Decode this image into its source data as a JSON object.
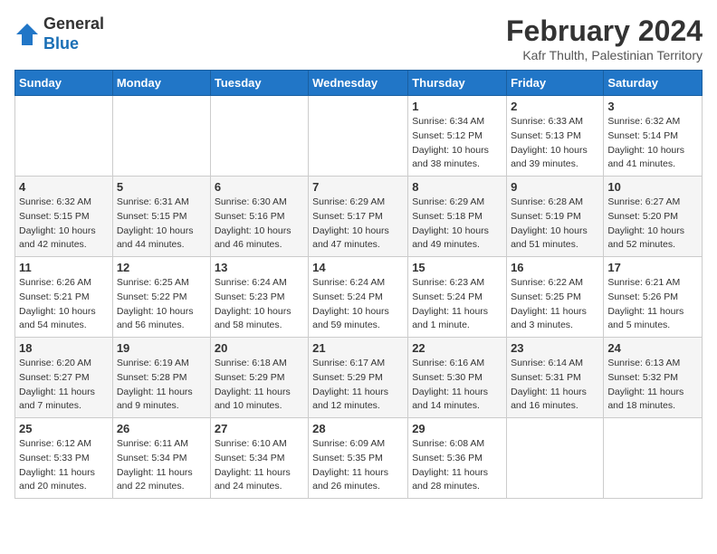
{
  "header": {
    "logo": {
      "line1": "General",
      "line2": "Blue"
    },
    "month_year": "February 2024",
    "location": "Kafr Thulth, Palestinian Territory"
  },
  "weekdays": [
    "Sunday",
    "Monday",
    "Tuesday",
    "Wednesday",
    "Thursday",
    "Friday",
    "Saturday"
  ],
  "weeks": [
    [
      {
        "day": "",
        "sunrise": "",
        "sunset": "",
        "daylight": ""
      },
      {
        "day": "",
        "sunrise": "",
        "sunset": "",
        "daylight": ""
      },
      {
        "day": "",
        "sunrise": "",
        "sunset": "",
        "daylight": ""
      },
      {
        "day": "",
        "sunrise": "",
        "sunset": "",
        "daylight": ""
      },
      {
        "day": "1",
        "sunrise": "Sunrise: 6:34 AM",
        "sunset": "Sunset: 5:12 PM",
        "daylight": "Daylight: 10 hours and 38 minutes."
      },
      {
        "day": "2",
        "sunrise": "Sunrise: 6:33 AM",
        "sunset": "Sunset: 5:13 PM",
        "daylight": "Daylight: 10 hours and 39 minutes."
      },
      {
        "day": "3",
        "sunrise": "Sunrise: 6:32 AM",
        "sunset": "Sunset: 5:14 PM",
        "daylight": "Daylight: 10 hours and 41 minutes."
      }
    ],
    [
      {
        "day": "4",
        "sunrise": "Sunrise: 6:32 AM",
        "sunset": "Sunset: 5:15 PM",
        "daylight": "Daylight: 10 hours and 42 minutes."
      },
      {
        "day": "5",
        "sunrise": "Sunrise: 6:31 AM",
        "sunset": "Sunset: 5:15 PM",
        "daylight": "Daylight: 10 hours and 44 minutes."
      },
      {
        "day": "6",
        "sunrise": "Sunrise: 6:30 AM",
        "sunset": "Sunset: 5:16 PM",
        "daylight": "Daylight: 10 hours and 46 minutes."
      },
      {
        "day": "7",
        "sunrise": "Sunrise: 6:29 AM",
        "sunset": "Sunset: 5:17 PM",
        "daylight": "Daylight: 10 hours and 47 minutes."
      },
      {
        "day": "8",
        "sunrise": "Sunrise: 6:29 AM",
        "sunset": "Sunset: 5:18 PM",
        "daylight": "Daylight: 10 hours and 49 minutes."
      },
      {
        "day": "9",
        "sunrise": "Sunrise: 6:28 AM",
        "sunset": "Sunset: 5:19 PM",
        "daylight": "Daylight: 10 hours and 51 minutes."
      },
      {
        "day": "10",
        "sunrise": "Sunrise: 6:27 AM",
        "sunset": "Sunset: 5:20 PM",
        "daylight": "Daylight: 10 hours and 52 minutes."
      }
    ],
    [
      {
        "day": "11",
        "sunrise": "Sunrise: 6:26 AM",
        "sunset": "Sunset: 5:21 PM",
        "daylight": "Daylight: 10 hours and 54 minutes."
      },
      {
        "day": "12",
        "sunrise": "Sunrise: 6:25 AM",
        "sunset": "Sunset: 5:22 PM",
        "daylight": "Daylight: 10 hours and 56 minutes."
      },
      {
        "day": "13",
        "sunrise": "Sunrise: 6:24 AM",
        "sunset": "Sunset: 5:23 PM",
        "daylight": "Daylight: 10 hours and 58 minutes."
      },
      {
        "day": "14",
        "sunrise": "Sunrise: 6:24 AM",
        "sunset": "Sunset: 5:24 PM",
        "daylight": "Daylight: 10 hours and 59 minutes."
      },
      {
        "day": "15",
        "sunrise": "Sunrise: 6:23 AM",
        "sunset": "Sunset: 5:24 PM",
        "daylight": "Daylight: 11 hours and 1 minute."
      },
      {
        "day": "16",
        "sunrise": "Sunrise: 6:22 AM",
        "sunset": "Sunset: 5:25 PM",
        "daylight": "Daylight: 11 hours and 3 minutes."
      },
      {
        "day": "17",
        "sunrise": "Sunrise: 6:21 AM",
        "sunset": "Sunset: 5:26 PM",
        "daylight": "Daylight: 11 hours and 5 minutes."
      }
    ],
    [
      {
        "day": "18",
        "sunrise": "Sunrise: 6:20 AM",
        "sunset": "Sunset: 5:27 PM",
        "daylight": "Daylight: 11 hours and 7 minutes."
      },
      {
        "day": "19",
        "sunrise": "Sunrise: 6:19 AM",
        "sunset": "Sunset: 5:28 PM",
        "daylight": "Daylight: 11 hours and 9 minutes."
      },
      {
        "day": "20",
        "sunrise": "Sunrise: 6:18 AM",
        "sunset": "Sunset: 5:29 PM",
        "daylight": "Daylight: 11 hours and 10 minutes."
      },
      {
        "day": "21",
        "sunrise": "Sunrise: 6:17 AM",
        "sunset": "Sunset: 5:29 PM",
        "daylight": "Daylight: 11 hours and 12 minutes."
      },
      {
        "day": "22",
        "sunrise": "Sunrise: 6:16 AM",
        "sunset": "Sunset: 5:30 PM",
        "daylight": "Daylight: 11 hours and 14 minutes."
      },
      {
        "day": "23",
        "sunrise": "Sunrise: 6:14 AM",
        "sunset": "Sunset: 5:31 PM",
        "daylight": "Daylight: 11 hours and 16 minutes."
      },
      {
        "day": "24",
        "sunrise": "Sunrise: 6:13 AM",
        "sunset": "Sunset: 5:32 PM",
        "daylight": "Daylight: 11 hours and 18 minutes."
      }
    ],
    [
      {
        "day": "25",
        "sunrise": "Sunrise: 6:12 AM",
        "sunset": "Sunset: 5:33 PM",
        "daylight": "Daylight: 11 hours and 20 minutes."
      },
      {
        "day": "26",
        "sunrise": "Sunrise: 6:11 AM",
        "sunset": "Sunset: 5:34 PM",
        "daylight": "Daylight: 11 hours and 22 minutes."
      },
      {
        "day": "27",
        "sunrise": "Sunrise: 6:10 AM",
        "sunset": "Sunset: 5:34 PM",
        "daylight": "Daylight: 11 hours and 24 minutes."
      },
      {
        "day": "28",
        "sunrise": "Sunrise: 6:09 AM",
        "sunset": "Sunset: 5:35 PM",
        "daylight": "Daylight: 11 hours and 26 minutes."
      },
      {
        "day": "29",
        "sunrise": "Sunrise: 6:08 AM",
        "sunset": "Sunset: 5:36 PM",
        "daylight": "Daylight: 11 hours and 28 minutes."
      },
      {
        "day": "",
        "sunrise": "",
        "sunset": "",
        "daylight": ""
      },
      {
        "day": "",
        "sunrise": "",
        "sunset": "",
        "daylight": ""
      }
    ]
  ]
}
